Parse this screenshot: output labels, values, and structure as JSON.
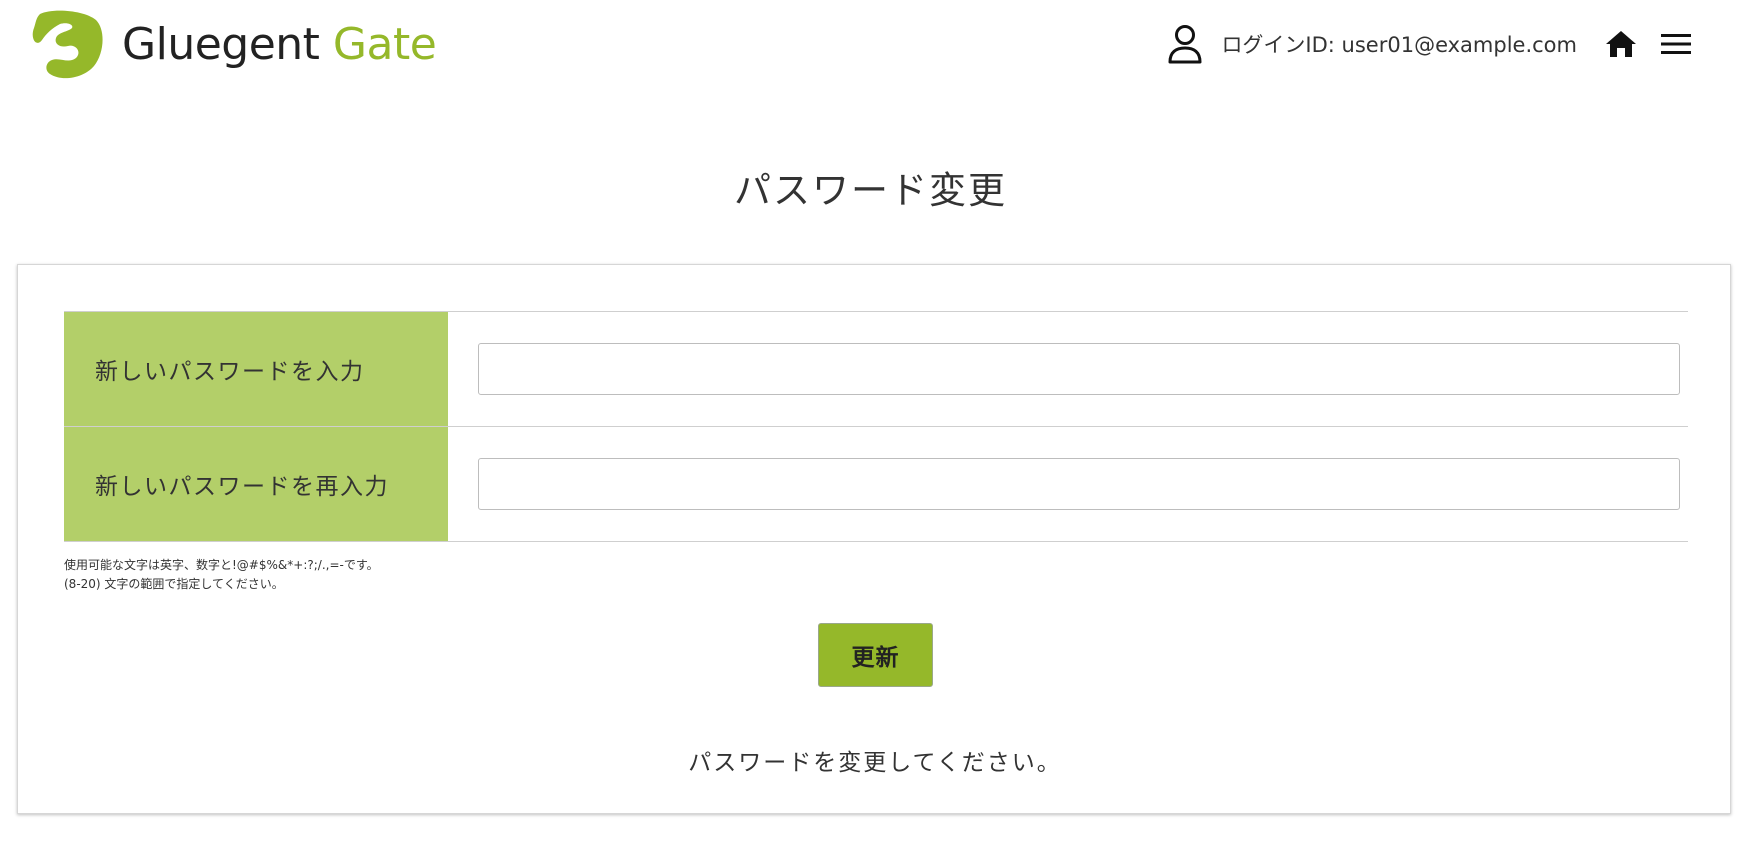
{
  "header": {
    "logo_text_primary": "Gluegent",
    "logo_text_accent": "Gate",
    "login_id_text": "ログインID: user01@example.com",
    "user_icon": "user-icon",
    "home_icon": "home-icon",
    "menu_icon": "hamburger-menu-icon"
  },
  "page": {
    "title": "パスワード変更"
  },
  "form": {
    "rows": [
      {
        "label": "新しいパスワードを入力",
        "value": "",
        "placeholder": ""
      },
      {
        "label": "新しいパスワードを再入力",
        "value": "",
        "placeholder": ""
      }
    ],
    "hint_line1": "使用可能な文字は英字、数字と!@#$%&*+:?;/.,=-です。",
    "hint_line2": "(8-20) 文字の範囲で指定してください。",
    "submit_label": "更新",
    "message": "パスワードを変更してください。"
  },
  "colors": {
    "brand_green": "#95b82a",
    "label_green": "#b3cf69",
    "text": "#333333"
  }
}
